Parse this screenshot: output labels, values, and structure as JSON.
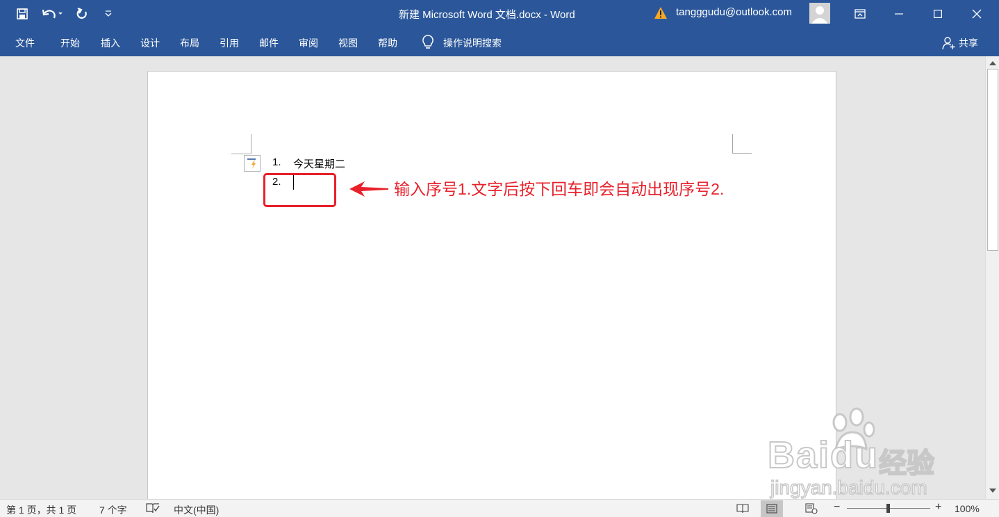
{
  "titlebar": {
    "title": "新建 Microsoft Word 文档.docx  -  Word",
    "account": "tangggudu@outlook.com",
    "color": "#2b579a"
  },
  "menu": {
    "tabs": [
      "文件",
      "开始",
      "插入",
      "设计",
      "布局",
      "引用",
      "邮件",
      "审阅",
      "视图",
      "帮助"
    ],
    "tell_me": "操作说明搜索",
    "share": "共享"
  },
  "document": {
    "list": [
      {
        "number": "1.",
        "text": "今天星期二"
      },
      {
        "number": "2.",
        "text": ""
      }
    ],
    "annotation": "输入序号1.文字后按下回车即会自动出现序号2.",
    "annotation_color": "#e8202a"
  },
  "watermark": {
    "brand": "Bai",
    "brand2": "du",
    "cn": "经验",
    "url": "jingyan.baidu.com"
  },
  "status": {
    "page": "第 1 页，共 1 页",
    "words": "7 个字",
    "language": "中文(中国)",
    "zoom": "100%",
    "zoom_level": 100
  }
}
